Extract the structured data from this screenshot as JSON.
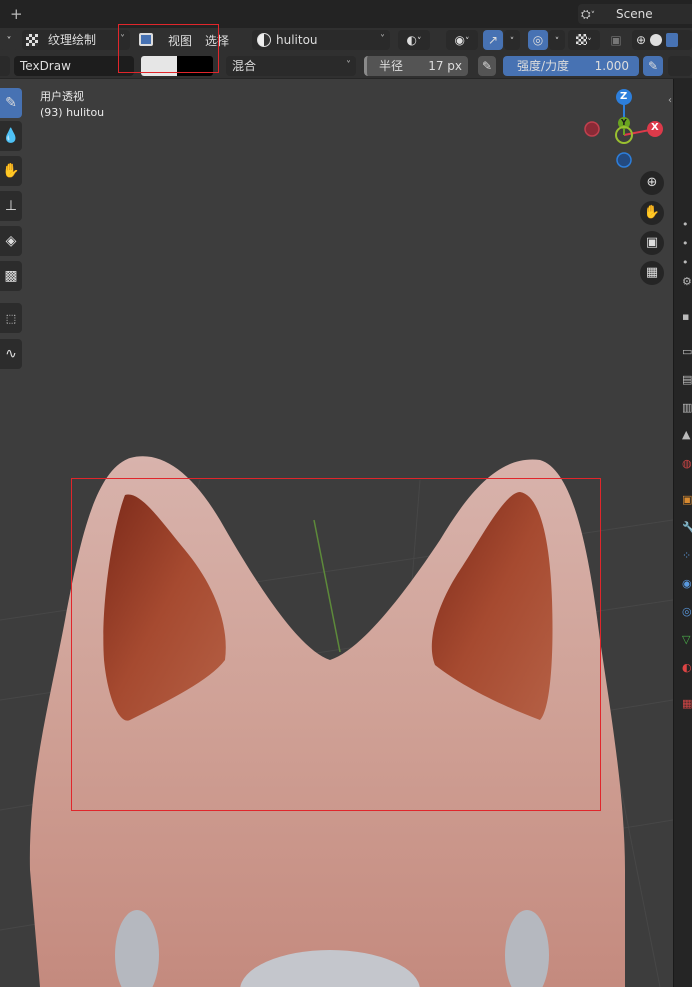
{
  "topbar": {
    "add_tab_label": "+",
    "scene_label": "Scene"
  },
  "header": {
    "mode_label": "纹理绘制",
    "menu_view": "视图",
    "menu_select": "选择",
    "object_name": "hulitou"
  },
  "tool_settings": {
    "brush_name": "TexDraw",
    "blend_label": "混合",
    "radius_label": "半径",
    "radius_value": "17 px",
    "strength_label": "强度/力度",
    "strength_value": "1.000",
    "color_primary": "#e6e6e6",
    "color_secondary": "#000000"
  },
  "viewport": {
    "view_name": "用户透视",
    "object_info": "(93) hulitou",
    "gizmo_axes": [
      "Z",
      "Y",
      "X"
    ],
    "axis_colors": {
      "x": "#dd3a4a",
      "y": "#6aa420",
      "z": "#2d7fdc"
    }
  },
  "colors": {
    "accent_blue": "#4772b3",
    "highlight_box": "#e0262b",
    "model_skin": "#c69288",
    "ear_inner": "#a4402a"
  }
}
